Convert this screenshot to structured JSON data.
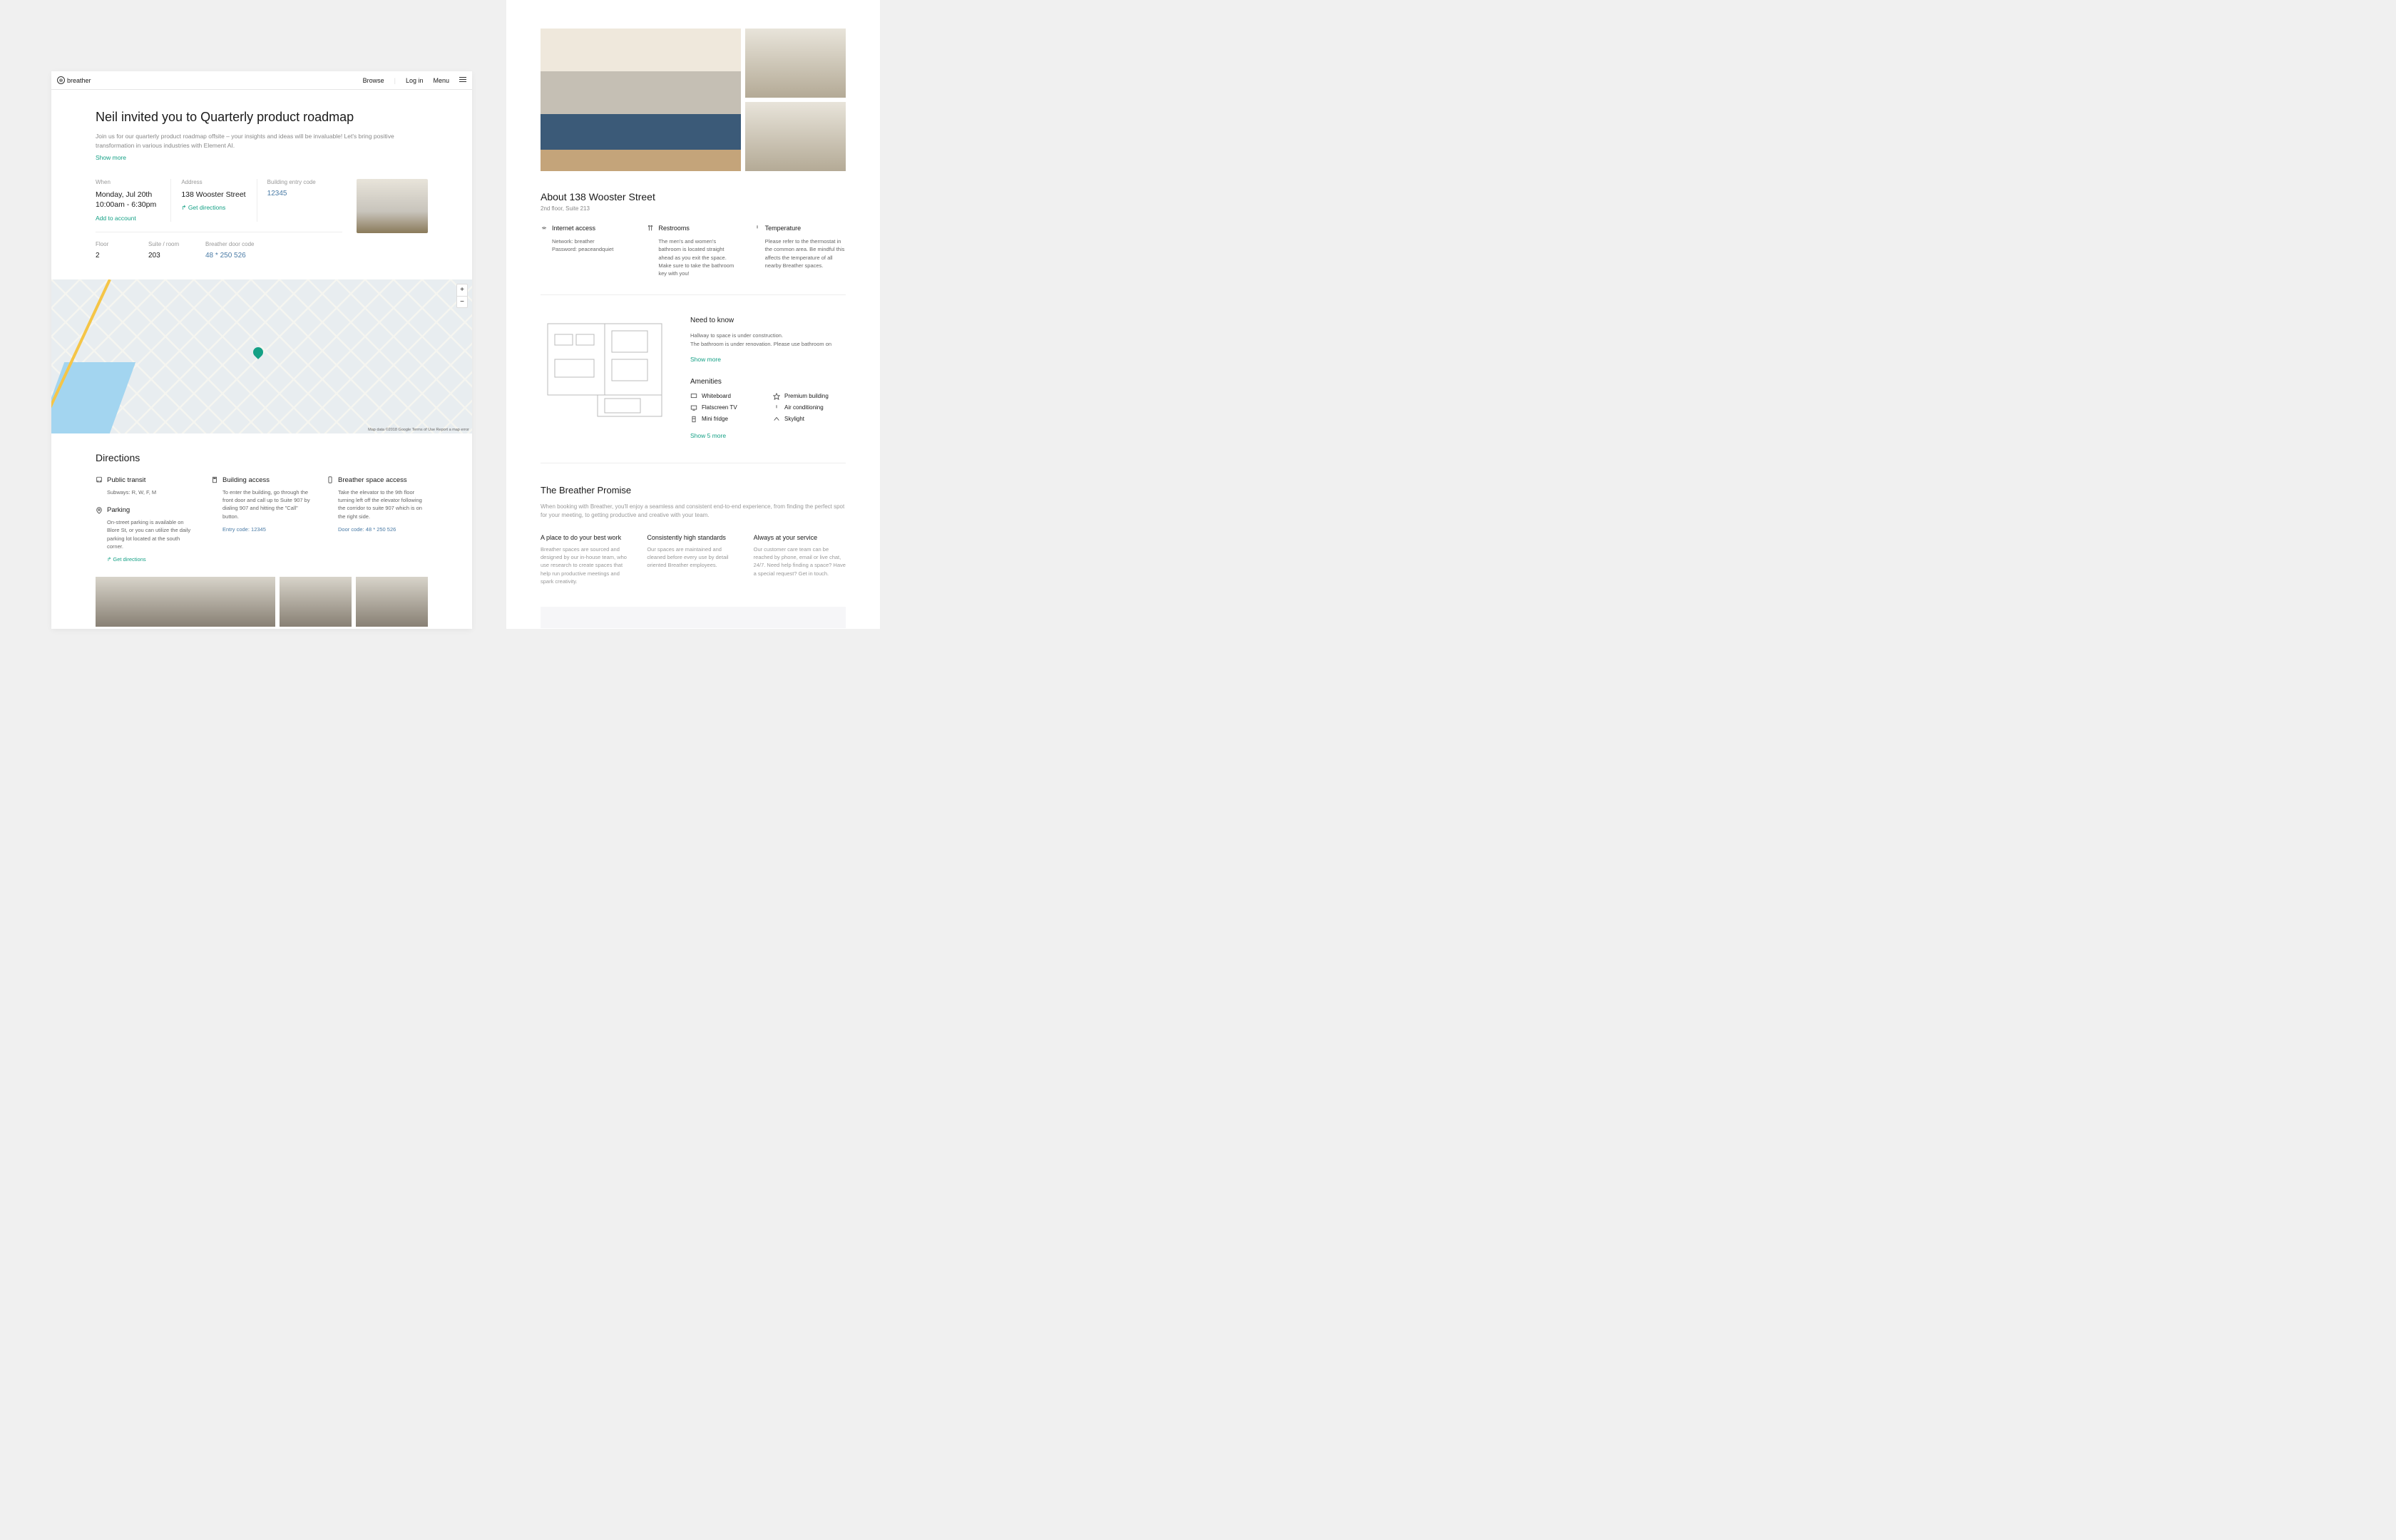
{
  "brand": "breather",
  "nav": {
    "browse": "Browse",
    "login": "Log in",
    "menu": "Menu"
  },
  "invite": {
    "title": "Neil invited you to Quarterly product roadmap",
    "desc": "Join us for our quarterly product roadmap offsite – your insights and ideas will be invaluable! Let's bring positive transformation in various industries with Element AI.",
    "show_more": "Show more"
  },
  "details": {
    "when_label": "When",
    "when_date": "Monday, Jul 20th",
    "when_time": "10:00am - 6:30pm",
    "add_calendar": "Add to account",
    "address_label": "Address",
    "address": "138 Wooster Street",
    "get_directions": "Get directions",
    "entry_label": "Building entry code",
    "entry_code": "12345",
    "floor_label": "Floor",
    "floor": "2",
    "suite_label": "Suite / room",
    "suite": "203",
    "door_label": "Breather door code",
    "door_code": "48 * 250 526"
  },
  "map": {
    "attrib": "Map data ©2018 Google   Terms of Use   Report a map error"
  },
  "directions": {
    "heading": "Directions",
    "transit_h": "Public transit",
    "transit_b": "Subways: R, W, F, M",
    "parking_h": "Parking",
    "parking_b": "On-street parking is available on Blore St, or you can utilize the daily parking lot located at the south corner.",
    "parking_link": "Get directions",
    "building_h": "Building access",
    "building_b": "To enter the building, go through the front door and call up to Suite 907 by dialing 907 and hitting the \"Call\" button.",
    "building_link": "Entry code: 12345",
    "space_h": "Breather space access",
    "space_b": "Take the elevator to the 9th floor turning left off the elevator following the corridor to suite 907 which is on the right side.",
    "space_link": "Door code: 48 * 250 526"
  },
  "about": {
    "heading": "About 138 Wooster Street",
    "sub": "2nd floor, Suite 213",
    "internet_h": "Internet access",
    "internet_b": "Network: breather\nPassword: peaceandquiet",
    "restrooms_h": "Restrooms",
    "restrooms_b": "The men's and women's bathroom is located straight ahead as you exit the space. Make sure to take the bathroom key with you!",
    "temp_h": "Temperature",
    "temp_b": "Please refer to the thermostat in the common area. Be mindful this affects the temperature of all nearby Breather spaces."
  },
  "know": {
    "heading": "Need to know",
    "body": "Hallway to space is under construction.\nThe bathroom is under renovation. Please use bathroom on",
    "show_more": "Show more",
    "amenities_h": "Amenities",
    "amenities": [
      "Whiteboard",
      "Premium building",
      "Flatscreen TV",
      "Air conditioning",
      "Mini fridge",
      "Skylight"
    ],
    "show_5": "Show 5 more"
  },
  "promise": {
    "heading": "The Breather Promise",
    "lead": "When booking with Breather, you'll enjoy a seamless and consistent end-to-end experience, from finding the perfect spot for your meeting, to getting productive and creative with your team.",
    "cols": [
      {
        "h": "A place to do your best work",
        "b": "Breather spaces are sourced and designed by our in-house team, who use research to create spaces that help run productive meetings and spark creativity."
      },
      {
        "h": "Consistently high standards",
        "b": "Our spaces are maintained and cleaned before every use by detail oriented Breather employees."
      },
      {
        "h": "Always at your service",
        "b": "Our customer care team can be reached by phone, email or live chat, 24/7. Need help finding a space? Have a special request? Get in touch."
      }
    ]
  }
}
